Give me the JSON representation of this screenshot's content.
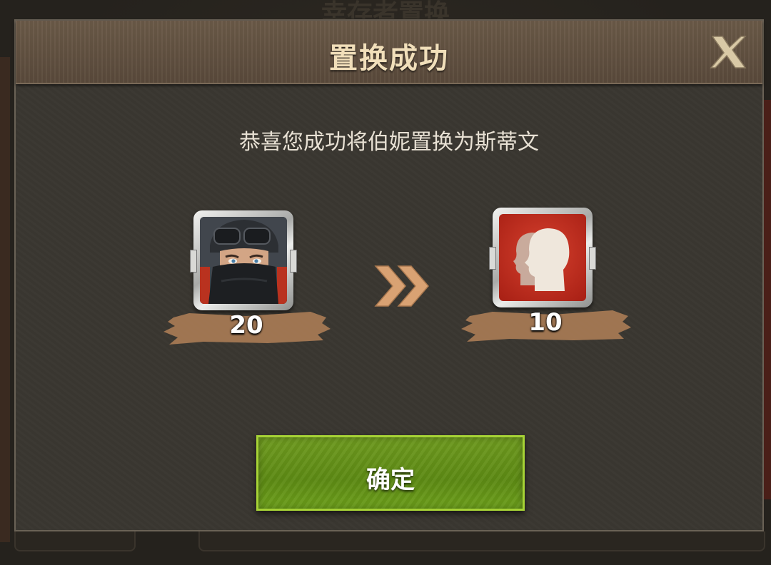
{
  "background": {
    "screen_title": "幸存者置换"
  },
  "dialog": {
    "title": "置换成功",
    "message": "恭喜您成功将伯妮置换为斯蒂文",
    "from_item": {
      "icon": "masked-soldier-portrait-icon",
      "count": "20"
    },
    "to_item": {
      "icon": "survivor-silhouettes-icon",
      "count": "10"
    },
    "arrow_icon": "double-chevron-right-icon",
    "confirm_label": "确定",
    "close_icon": "close-icon"
  },
  "colors": {
    "title": "#f1dfba",
    "confirm_green": "#6e9a1f",
    "confirm_border": "#a6d236",
    "item_red": "#c0301f",
    "arrow": "#d9a273"
  }
}
